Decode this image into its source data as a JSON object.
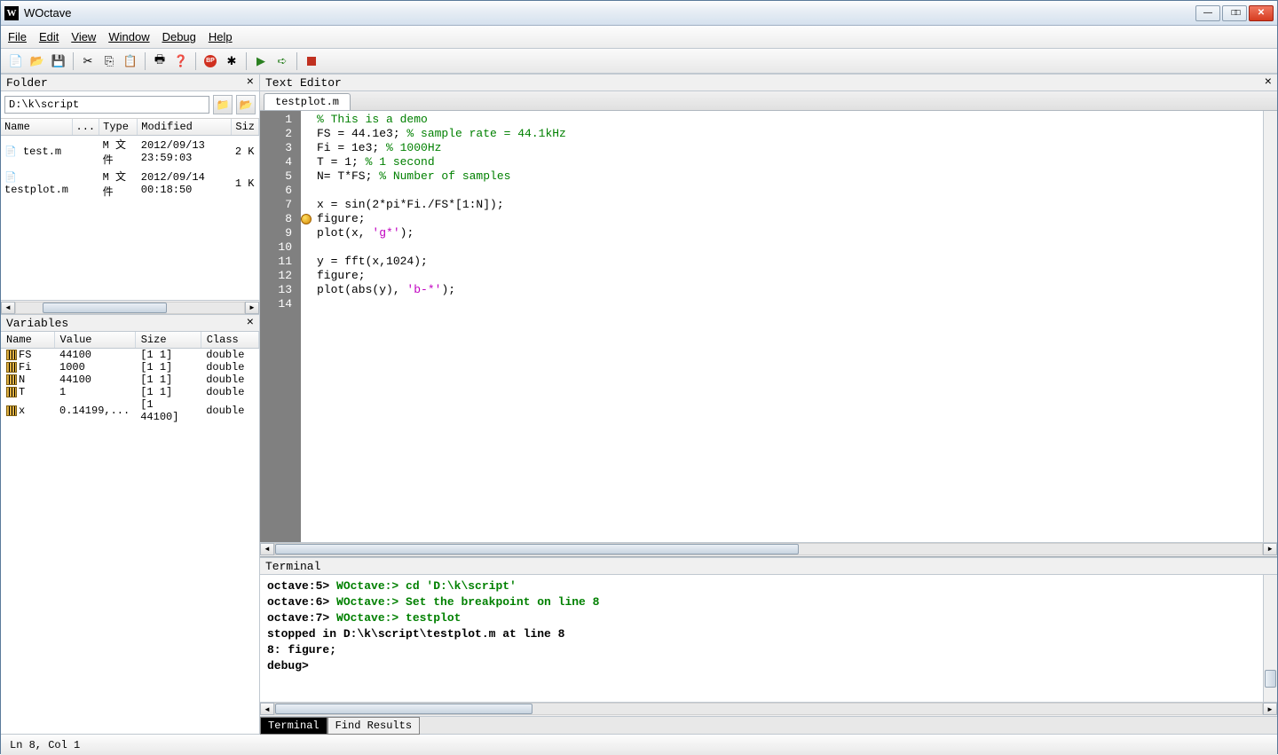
{
  "app": {
    "title": "WOctave",
    "icon_letter": "W"
  },
  "menus": [
    "File",
    "Edit",
    "View",
    "Window",
    "Debug",
    "Help"
  ],
  "toolbar": {
    "new": "new-file-icon",
    "open": "open-file-icon",
    "save": "save-icon",
    "cut": "cut-icon",
    "copy": "copy-icon",
    "paste": "paste-icon",
    "print": "print-icon",
    "help": "help-icon",
    "stop": "stop-icon",
    "clear_bp": "clear-breakpoints-icon",
    "run": "run-icon",
    "step": "step-icon",
    "stop2": "stop-square-icon"
  },
  "folder_panel": {
    "title": "Folder",
    "path": "D:\\k\\script",
    "headers": {
      "name": "Name",
      "ext": "...",
      "type": "Type",
      "modified": "Modified",
      "size": "Siz"
    },
    "files": [
      {
        "name": "test.m",
        "type": "M 文件",
        "modified": "2012/09/13 23:59:03",
        "size": "2 K"
      },
      {
        "name": "testplot.m",
        "type": "M 文件",
        "modified": "2012/09/14 00:18:50",
        "size": "1 K"
      }
    ]
  },
  "variables_panel": {
    "title": "Variables",
    "headers": {
      "name": "Name",
      "value": "Value",
      "size": "Size",
      "class": "Class"
    },
    "vars": [
      {
        "name": "FS",
        "value": "44100",
        "size": "[1   1]",
        "class": "double"
      },
      {
        "name": "Fi",
        "value": "1000",
        "size": "[1   1]",
        "class": "double"
      },
      {
        "name": "N",
        "value": "44100",
        "size": "[1   1]",
        "class": "double"
      },
      {
        "name": "T",
        "value": "1",
        "size": "[1   1]",
        "class": "double"
      },
      {
        "name": "x",
        "value": "0.14199,...",
        "size": "[1  44100]",
        "class": "double"
      }
    ]
  },
  "editor": {
    "title": "Text Editor",
    "tab": "testplot.m",
    "breakpoint_line": 8,
    "lines": [
      {
        "n": 1,
        "segs": [
          {
            "t": "% This is a demo",
            "c": "c-comment"
          }
        ]
      },
      {
        "n": 2,
        "segs": [
          {
            "t": "FS = 44.1e3; "
          },
          {
            "t": "% sample rate = 44.1kHz",
            "c": "c-comment"
          }
        ]
      },
      {
        "n": 3,
        "segs": [
          {
            "t": "Fi = 1e3; "
          },
          {
            "t": "% 1000Hz",
            "c": "c-comment"
          }
        ]
      },
      {
        "n": 4,
        "segs": [
          {
            "t": "T = 1; "
          },
          {
            "t": "% 1 second",
            "c": "c-comment"
          }
        ]
      },
      {
        "n": 5,
        "segs": [
          {
            "t": "N= T*FS; "
          },
          {
            "t": "% Number of samples",
            "c": "c-comment"
          }
        ]
      },
      {
        "n": 6,
        "segs": [
          {
            "t": ""
          }
        ]
      },
      {
        "n": 7,
        "segs": [
          {
            "t": "x = sin(2*pi*Fi./FS*[1:N]);"
          }
        ]
      },
      {
        "n": 8,
        "segs": [
          {
            "t": "figure;"
          }
        ]
      },
      {
        "n": 9,
        "segs": [
          {
            "t": "plot(x, "
          },
          {
            "t": "'g*'",
            "c": "c-string"
          },
          {
            "t": ");"
          }
        ]
      },
      {
        "n": 10,
        "segs": [
          {
            "t": ""
          }
        ]
      },
      {
        "n": 11,
        "segs": [
          {
            "t": "y = fft(x,1024);"
          }
        ]
      },
      {
        "n": 12,
        "segs": [
          {
            "t": "figure;"
          }
        ]
      },
      {
        "n": 13,
        "segs": [
          {
            "t": "plot(abs(y), "
          },
          {
            "t": "'b-*'",
            "c": "c-string"
          },
          {
            "t": ");"
          }
        ]
      },
      {
        "n": 14,
        "segs": [
          {
            "t": ""
          }
        ]
      }
    ]
  },
  "terminal": {
    "title": "Terminal",
    "lines": [
      {
        "segs": [
          {
            "t": "octave:5> "
          },
          {
            "t": "WOctave:> cd 'D:\\k\\script'",
            "c": "term-green"
          }
        ]
      },
      {
        "segs": [
          {
            "t": "octave:6> "
          },
          {
            "t": "WOctave:> Set the breakpoint on line 8",
            "c": "term-green"
          }
        ]
      },
      {
        "segs": [
          {
            "t": "octave:7> "
          },
          {
            "t": "WOctave:> testplot",
            "c": "term-green"
          }
        ]
      },
      {
        "segs": [
          {
            "t": "stopped in D:\\k\\script\\testplot.m at line 8"
          }
        ]
      },
      {
        "segs": [
          {
            "t": "8: figure;"
          }
        ]
      },
      {
        "segs": [
          {
            "t": "debug>"
          }
        ]
      }
    ],
    "tabs": {
      "terminal": "Terminal",
      "find": "Find Results"
    }
  },
  "status": {
    "text": "Ln 8,   Col 1"
  }
}
